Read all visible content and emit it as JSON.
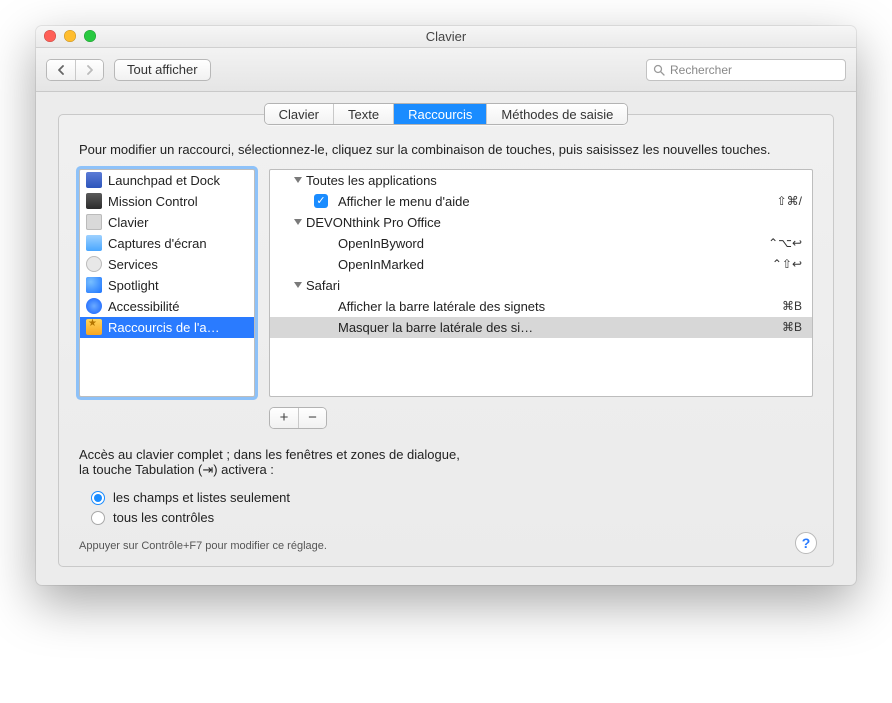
{
  "window": {
    "title": "Clavier"
  },
  "toolbar": {
    "show_all": "Tout afficher",
    "search_placeholder": "Rechercher"
  },
  "tabs": {
    "keyboard": "Clavier",
    "text": "Texte",
    "shortcuts": "Raccourcis",
    "input_methods": "Méthodes de saisie"
  },
  "instructions": "Pour modifier un raccourci, sélectionnez-le, cliquez sur la combinaison de touches, puis saisissez les nouvelles touches.",
  "categories": [
    {
      "label": "Launchpad et Dock"
    },
    {
      "label": "Mission Control"
    },
    {
      "label": "Clavier"
    },
    {
      "label": "Captures d'écran"
    },
    {
      "label": "Services"
    },
    {
      "label": "Spotlight"
    },
    {
      "label": "Accessibilité"
    },
    {
      "label": "Raccourcis de l'a…"
    }
  ],
  "tree": {
    "g0": "Toutes les applications",
    "g0_i0": {
      "label": "Afficher le menu d'aide",
      "shortcut": "⇧⌘/"
    },
    "g1": "DEVONthink Pro Office",
    "g1_i0": {
      "label": "OpenInByword",
      "shortcut": "⌃⌥↩"
    },
    "g1_i1": {
      "label": "OpenInMarked",
      "shortcut": "⌃⇧↩"
    },
    "g2": "Safari",
    "g2_i0": {
      "label": "Afficher la barre latérale des signets",
      "shortcut": "⌘B"
    },
    "g2_i1": {
      "label": "Masquer la barre latérale des si…",
      "shortcut": "⌘B"
    }
  },
  "buttons": {
    "add": "+",
    "remove": "−"
  },
  "keyboard_access": {
    "heading_line1": "Accès au clavier complet ; dans les fenêtres et zones de dialogue,",
    "heading_line2": "la touche Tabulation (⇥) activera :",
    "opt_fields": "les champs et listes seulement",
    "opt_all": "tous les contrôles",
    "hint": "Appuyer sur Contrôle+F7 pour modifier ce réglage."
  },
  "help": "?"
}
